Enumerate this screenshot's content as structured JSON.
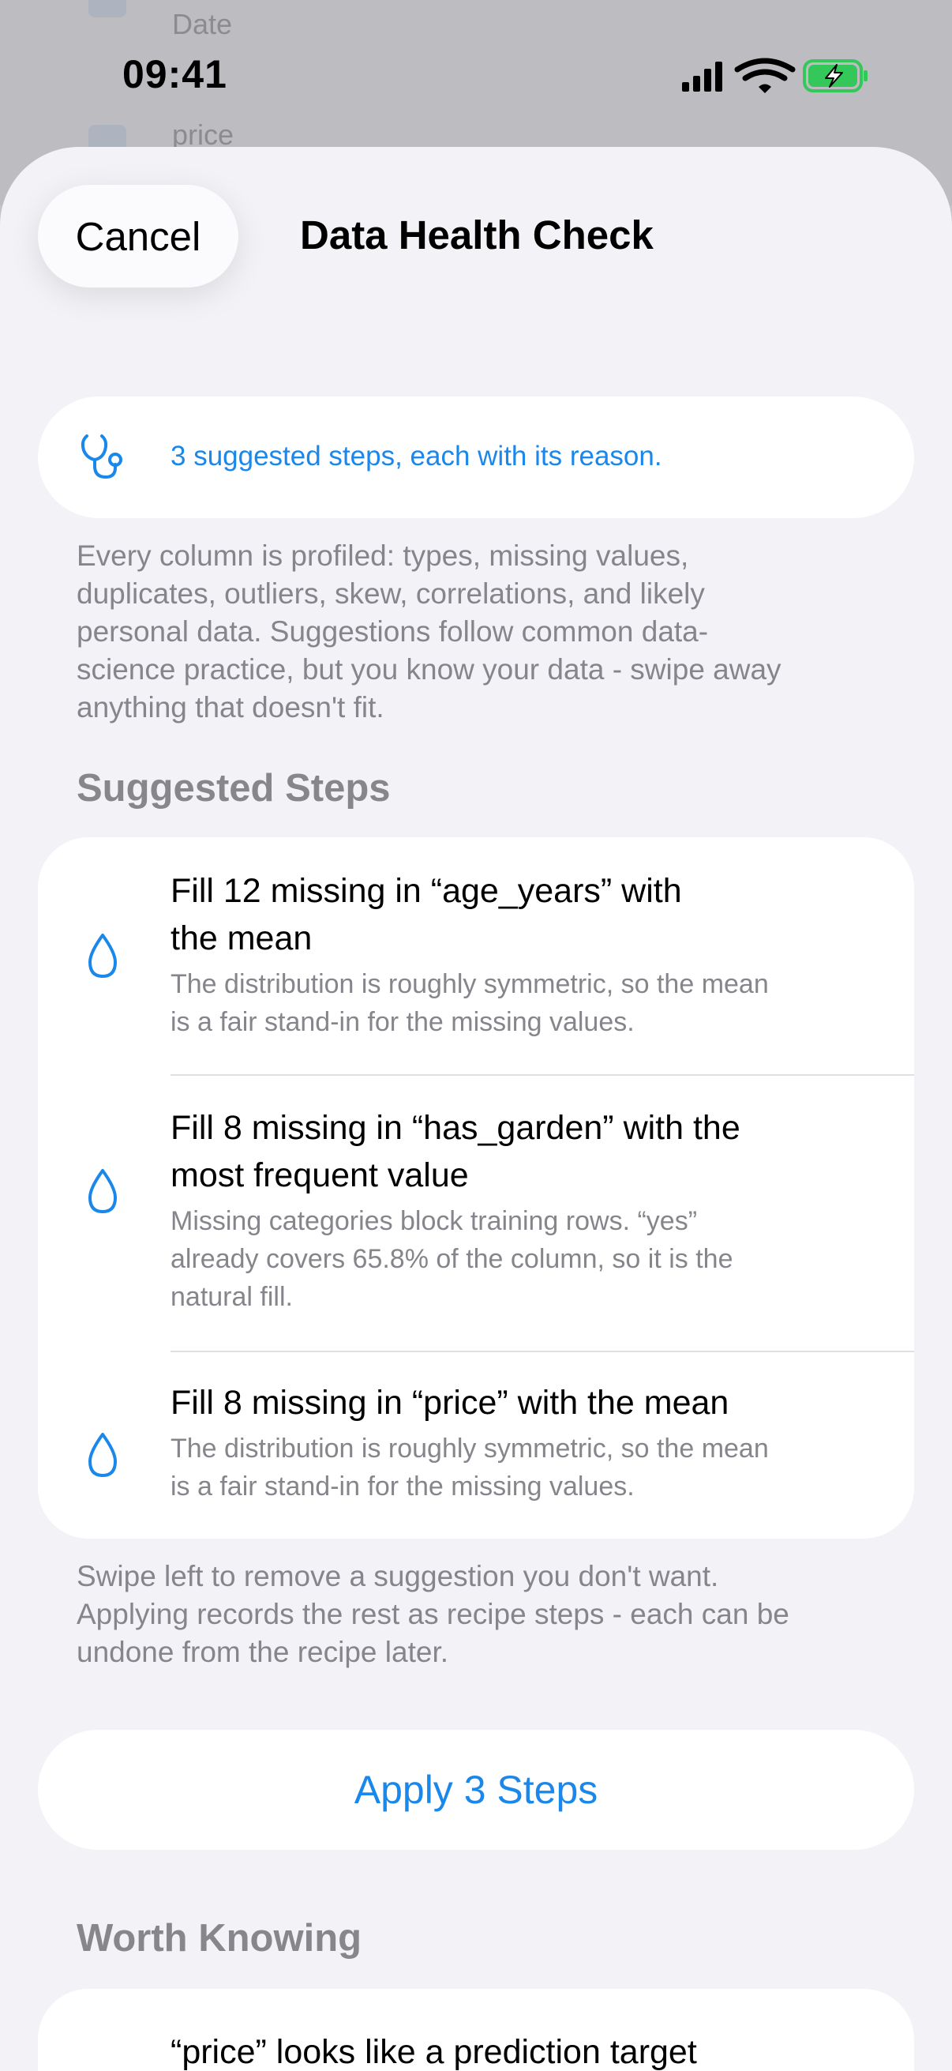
{
  "status_bar": {
    "time": "09:41"
  },
  "background": {
    "rows": [
      "Date",
      "price"
    ]
  },
  "sheet": {
    "cancel_label": "Cancel",
    "title": "Data Health Check"
  },
  "banner": {
    "icon": "stethoscope-icon",
    "text": "3 suggested steps, each with its reason."
  },
  "intro": {
    "lines": [
      "Every column is profiled: types, missing values,",
      "duplicates, outliers, skew, correlations, and likely",
      "personal data. Suggestions follow common data-",
      "science practice, but you know your data - swipe away",
      "anything that doesn't fit."
    ]
  },
  "suggested": {
    "header": "Suggested Steps",
    "steps": [
      {
        "icon": "drop-icon",
        "title": [
          "Fill 12 missing in “age_years” with",
          "the mean"
        ],
        "reason": [
          "The distribution is roughly symmetric, so the mean",
          "is a fair stand-in for the missing values."
        ]
      },
      {
        "icon": "drop-icon",
        "title": [
          "Fill 8 missing in “has_garden” with the",
          "most frequent value"
        ],
        "reason": [
          "Missing categories block training rows. “yes”",
          "already covers 65.8% of the column, so it is the",
          "natural fill."
        ]
      },
      {
        "icon": "drop-icon",
        "title": [
          "Fill 8 missing in “price” with the mean"
        ],
        "reason": [
          "The distribution is roughly symmetric, so the mean",
          "is a fair stand-in for the missing values."
        ]
      }
    ],
    "footer_lines": [
      "Swipe left to remove a suggestion you don't want.",
      "Applying records the rest as recipe steps - each can be",
      "undone from the recipe later."
    ]
  },
  "apply_label": "Apply 3 Steps",
  "worth_knowing": {
    "header": "Worth Knowing",
    "first_item": "“price” looks like a prediction target"
  },
  "colors": {
    "accent": "#1a87ea",
    "battery": "#34c759",
    "secondary_text": "#85858b",
    "sheet_background": "#f2f2f7"
  }
}
